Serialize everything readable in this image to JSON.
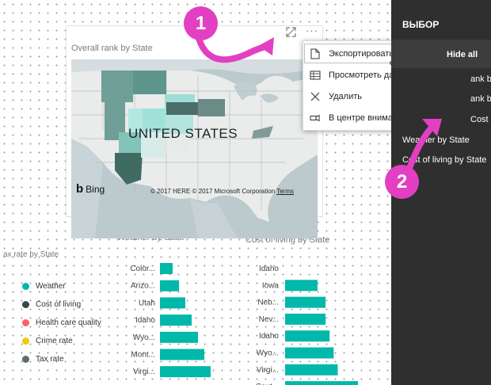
{
  "map_visual": {
    "title": "Overall rank by State",
    "map_label": "UNITED STATES",
    "bing_label": "Bing",
    "copyright": "© 2017 HERE © 2017 Microsoft Corporation",
    "terms_link": "Terms",
    "focus_icon": "expand-icon",
    "more_icon": "ellipsis-icon"
  },
  "context_menu": {
    "items": [
      {
        "label": "Экспортировать данные",
        "icon": "export-icon"
      },
      {
        "label": "Просмотреть данные",
        "icon": "table-icon"
      },
      {
        "label": "Удалить",
        "icon": "close-icon"
      },
      {
        "label": "В центре внимания",
        "icon": "spotlight-icon"
      }
    ]
  },
  "selection_pane": {
    "title": "ВЫБОР",
    "hide_all": "Hide all",
    "items": [
      "ank by State",
      "ank by State",
      "Cost of living",
      "Weather by State",
      "Cost of living by State"
    ]
  },
  "legend_visual": {
    "title": "ax rate by State",
    "items": [
      {
        "label": "Weather",
        "color": "#01b8aa"
      },
      {
        "label": "Cost of living",
        "color": "#374649"
      },
      {
        "label": "Health care quality",
        "color": "#fd625e"
      },
      {
        "label": "Crime rate",
        "color": "#f2c80f"
      },
      {
        "label": "Tax rate",
        "color": "#5f6b6d"
      }
    ]
  },
  "chart_data": [
    {
      "type": "bar",
      "title": "Weather by State",
      "orientation": "horizontal",
      "categories": [
        "Color...",
        "Arizo...",
        "Utah",
        "Idaho",
        "Wyo...",
        "Mont...",
        "Virgi..."
      ],
      "values": [
        2,
        3,
        4,
        5,
        6,
        7,
        8
      ],
      "color": "#01b8aa"
    },
    {
      "type": "bar",
      "title": "Cost of living by State",
      "orientation": "horizontal",
      "categories": [
        "Idaho",
        "Iowa",
        "Neb...",
        "Nev...",
        "Idaho",
        "Wyo...",
        "Virgi...",
        "Sout..."
      ],
      "values": [
        0,
        8,
        10,
        10,
        11,
        12,
        13,
        18
      ],
      "color": "#01b8aa"
    }
  ],
  "callouts": [
    "1",
    "2"
  ],
  "colors": {
    "accent": "#01b8aa",
    "callout": "#e33fc2",
    "pane": "#2f2f2f"
  }
}
